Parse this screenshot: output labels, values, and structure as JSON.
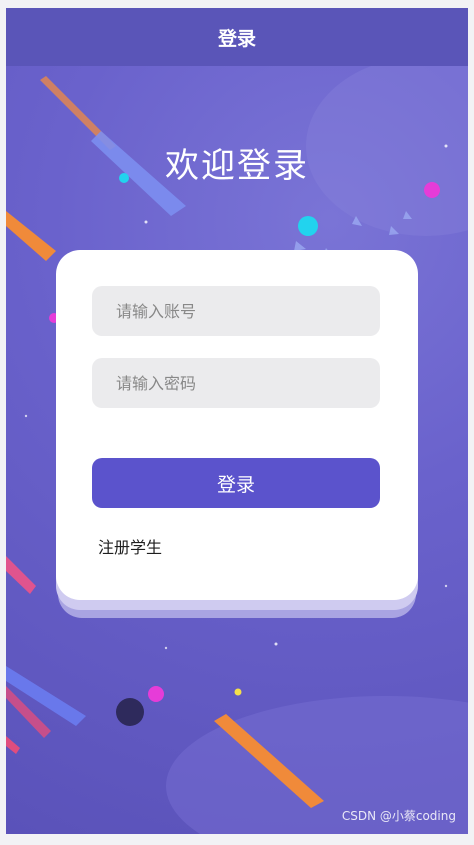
{
  "header": {
    "title": "登录"
  },
  "welcome": {
    "title": "欢迎登录"
  },
  "form": {
    "account_placeholder": "请输入账号",
    "password_placeholder": "请输入密码",
    "login_label": "登录",
    "register_link": "注册学生"
  },
  "watermark": "CSDN @小蔡coding",
  "colors": {
    "header_bg": "#5a55b8",
    "background": "#6a62cc",
    "button": "#5b53cc",
    "card": "#ffffff",
    "input_bg": "#ebebed"
  }
}
